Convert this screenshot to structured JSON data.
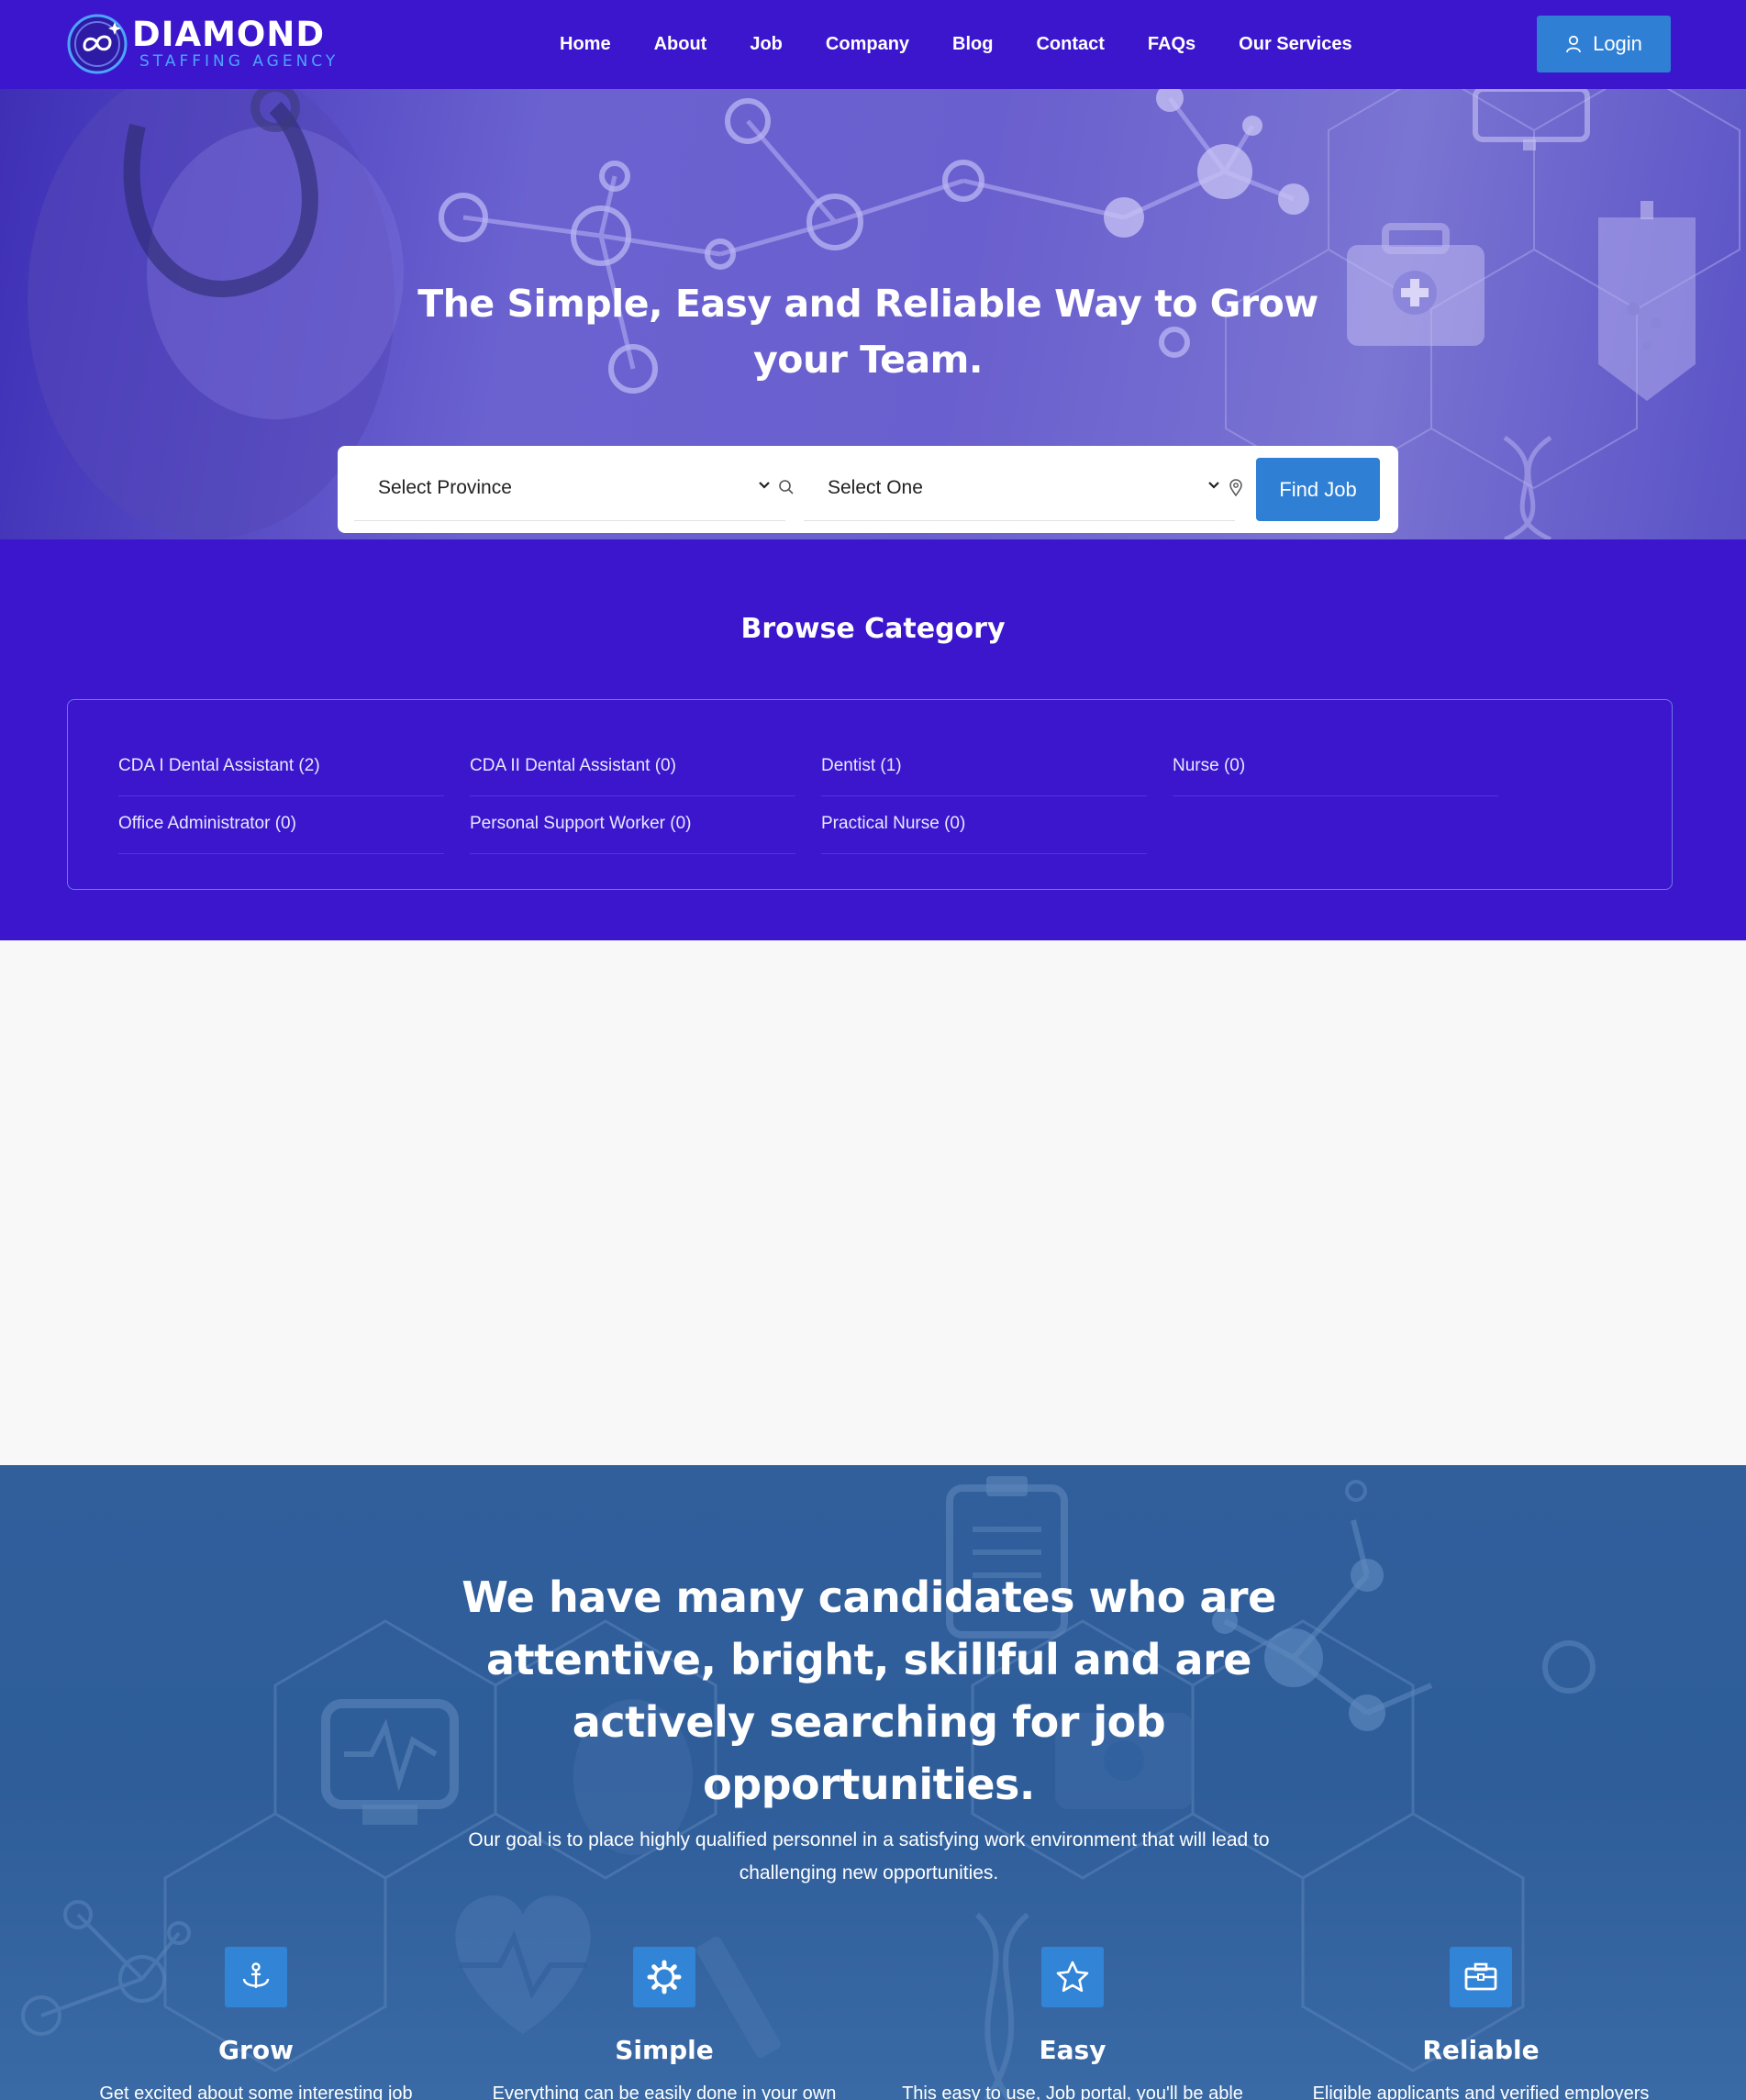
{
  "header": {
    "logo_name": "DIAMOND",
    "logo_sub": "STAFFING AGENCY",
    "nav": [
      "Home",
      "About",
      "Job",
      "Company",
      "Blog",
      "Contact",
      "FAQs",
      "Our Services"
    ],
    "login_label": "Login"
  },
  "hero": {
    "title": "The Simple, Easy and Reliable Way to Grow your Team.",
    "province_select": "Select Province",
    "category_select": "Select One",
    "find_label": "Find Job"
  },
  "browse": {
    "title": "Browse Category",
    "categories": [
      "CDA I Dental Assistant (2)",
      "CDA II Dental Assistant (0)",
      "Dentist (1)",
      "Nurse (0)",
      "Office Administrator (0)",
      "Personal Support Worker (0)",
      "Practical Nurse (0)"
    ]
  },
  "candidates": {
    "title": "We have many candidates who are attentive, bright, skillful and are actively searching for job opportunities.",
    "subtitle": "Our goal is to place highly qualified personnel in a satisfying work environment that will lead to challenging new opportunities.",
    "features": [
      {
        "icon": "anchor-icon",
        "title": "Grow",
        "desc": "Get excited about some interesting job"
      },
      {
        "icon": "cog-icon",
        "title": "Simple",
        "desc": "Everything can be easily done in your own"
      },
      {
        "icon": "star-icon",
        "title": "Easy",
        "desc": "This easy to use, Job portal, you'll be able"
      },
      {
        "icon": "briefcase-icon",
        "title": "Reliable",
        "desc": "Eligible applicants and verified employers"
      }
    ]
  },
  "colors": {
    "brand_purple": "#3b16cd",
    "accent_blue": "#2f80d4",
    "section_blue": "#2e5d9a"
  }
}
